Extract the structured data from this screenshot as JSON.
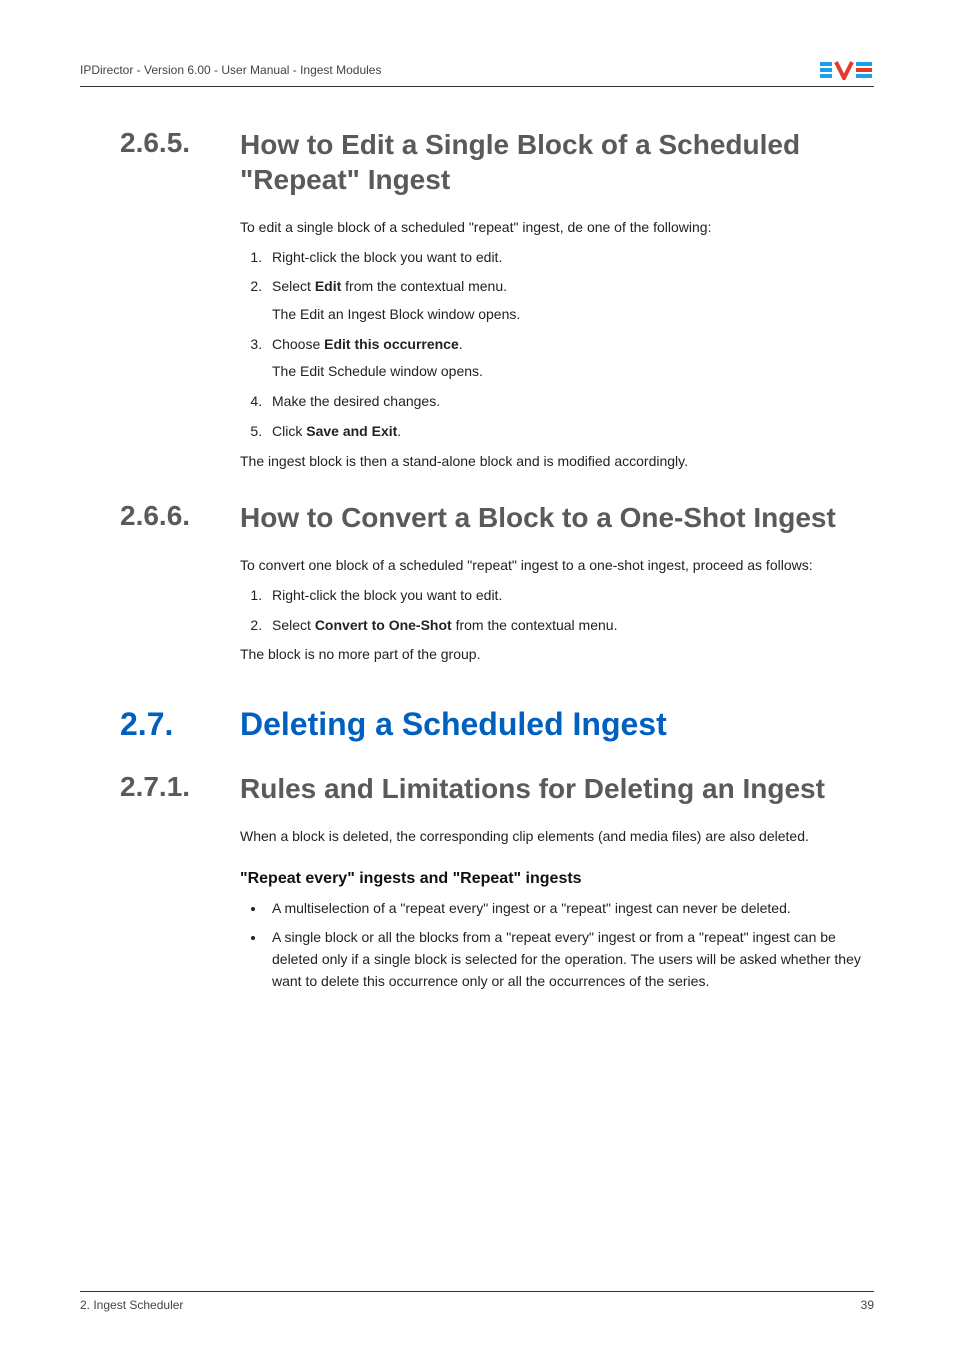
{
  "header": {
    "left": "IPDirector - Version 6.00 - User Manual - Ingest Modules"
  },
  "sec265": {
    "num": "2.6.5.",
    "title": "How to Edit a Single Block of a Scheduled \"Repeat\" Ingest",
    "intro": "To edit a single block of a scheduled \"repeat\" ingest, de one of the following:",
    "step1": "Right-click the block you want to edit.",
    "step2_pre": "Select ",
    "step2_bold": "Edit",
    "step2_post": " from the contextual menu.",
    "step2_sub": "The Edit an Ingest Block window opens.",
    "step3_pre": "Choose ",
    "step3_bold": "Edit this occurrence",
    "step3_post": ".",
    "step3_sub": "The Edit Schedule window opens.",
    "step4": "Make the desired changes.",
    "step5_pre": "Click ",
    "step5_bold": "Save and Exit",
    "step5_post": ".",
    "outro": "The ingest block is then a stand-alone block and is modified accordingly."
  },
  "sec266": {
    "num": "2.6.6.",
    "title": "How to Convert a Block to a One-Shot Ingest",
    "intro": "To convert one block of a scheduled \"repeat\" ingest to a one-shot ingest, proceed as follows:",
    "step1": "Right-click the block you want to edit.",
    "step2_pre": "Select ",
    "step2_bold": "Convert to One-Shot",
    "step2_post": " from the contextual menu.",
    "outro": "The block is no more part of the group."
  },
  "sec27": {
    "num": "2.7.",
    "title": "Deleting a Scheduled Ingest"
  },
  "sec271": {
    "num": "2.7.1.",
    "title": "Rules and Limitations for Deleting an Ingest",
    "intro": "When a block is deleted, the corresponding clip elements (and media files) are also deleted.",
    "h3": "\"Repeat every\" ingests and \"Repeat\" ingests",
    "b1": "A multiselection of a \"repeat every\" ingest or a \"repeat\" ingest can never be deleted.",
    "b2": "A single block or all the blocks from a \"repeat every\" ingest or from a \"repeat\" ingest can be deleted only if a single block is selected for the operation. The users will be asked whether they want to delete this occurrence only or all the occurrences of the series."
  },
  "footer": {
    "left": "2. Ingest Scheduler",
    "right": "39"
  }
}
